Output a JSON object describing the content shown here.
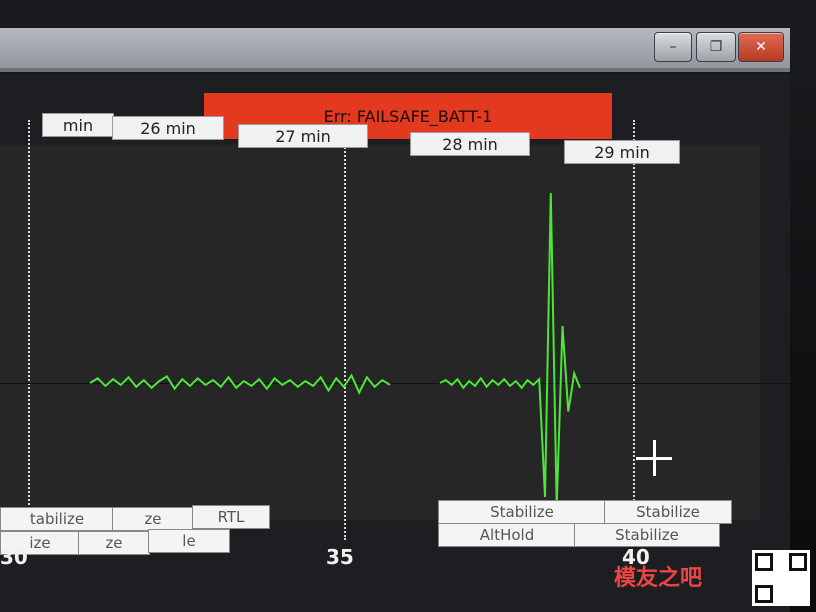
{
  "window": {
    "minimize_icon": "minimize-icon",
    "restore_icon": "restore-icon",
    "close_icon": "close-icon",
    "minimize_glyph": "–",
    "restore_glyph": "❐",
    "close_glyph": "✕"
  },
  "banner": {
    "error_text": "Err: FAILSAFE_BATT-1",
    "color": "#e2391f"
  },
  "time_labels": [
    "min",
    "26 min",
    "27 min",
    "28 min",
    "29 min"
  ],
  "mode_labels": {
    "row1": [
      "tabilize",
      "ze",
      "RTL",
      "Stabilize",
      "Stabilize"
    ],
    "row2": [
      "ize",
      "ze",
      "le",
      "AltHold",
      "Stabilize"
    ]
  },
  "axis_ticks": [
    "30",
    "35",
    "40"
  ],
  "watermark": {
    "text": "模友之吧"
  },
  "chart_data": {
    "type": "line",
    "series": [
      {
        "values": [
          0,
          5,
          -3,
          4,
          -2,
          6,
          -4,
          3,
          -5,
          2,
          7,
          -6,
          4,
          -3,
          5,
          -2,
          3,
          -4,
          6,
          -5,
          2,
          -3,
          4,
          -6,
          5,
          -2,
          3,
          -4,
          2,
          -3,
          6,
          -8,
          5,
          -4,
          8,
          -10,
          6,
          -4,
          3,
          -2
        ]
      },
      {
        "values": [
          0,
          3,
          -2,
          4,
          -5,
          2,
          -3,
          5,
          -4,
          3,
          -2,
          4,
          -3,
          2,
          -5,
          3,
          -2,
          4,
          -120,
          200,
          -130,
          60,
          -30,
          10,
          -5
        ]
      }
    ],
    "ylim": [
      -200,
      200
    ]
  }
}
